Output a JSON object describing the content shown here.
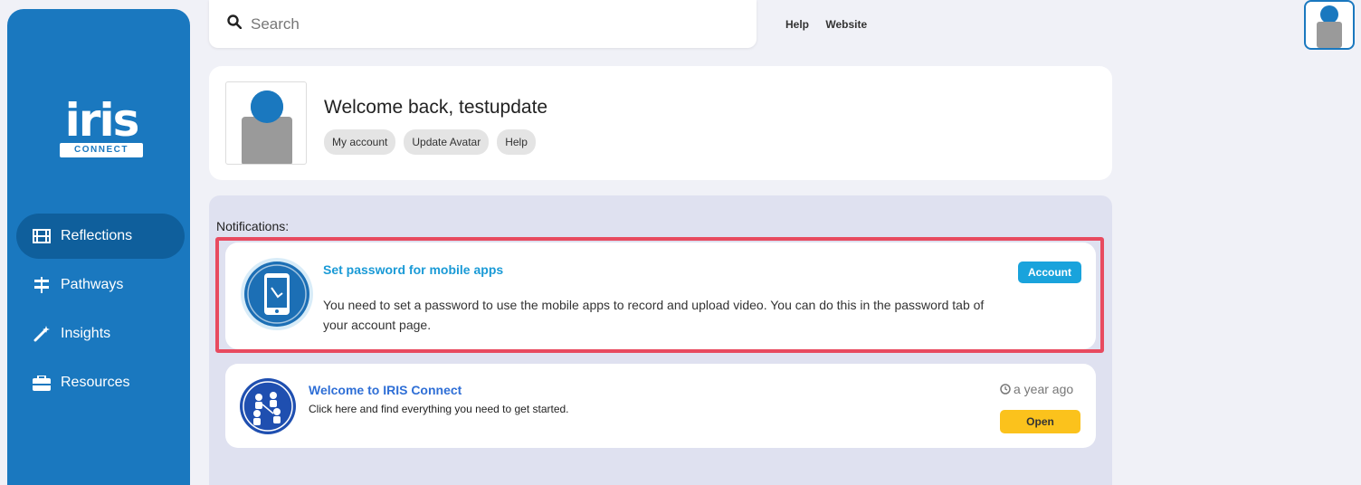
{
  "brand": {
    "logo_text": "iris",
    "logo_badge": "CONNECT",
    "color": "#1a78bf"
  },
  "sidebar": {
    "items": [
      {
        "label": "Reflections",
        "icon": "film-icon",
        "active": true
      },
      {
        "label": "Pathways",
        "icon": "signpost-icon",
        "active": false
      },
      {
        "label": "Insights",
        "icon": "magic-wand-icon",
        "active": false
      },
      {
        "label": "Resources",
        "icon": "briefcase-icon",
        "active": false
      }
    ]
  },
  "header": {
    "search_placeholder": "Search",
    "links": [
      "Help",
      "Website"
    ]
  },
  "welcome": {
    "title": "Welcome back, testupdate",
    "buttons": [
      "My account",
      "Update Avatar",
      "Help"
    ]
  },
  "notifications": {
    "heading": "Notifications:",
    "items": [
      {
        "title": "Set password for mobile apps",
        "body": "You need to set a password to use the mobile apps to record and upload video. You can do this in the password tab of your account page.",
        "action": "Account",
        "icon": "mobile-phone-icon",
        "highlighted": true
      },
      {
        "title": "Welcome to IRIS Connect",
        "body": "Click here and find everything you need to get started.",
        "timestamp": "a year ago",
        "action": "Open",
        "icon": "people-network-icon"
      }
    ]
  },
  "colors": {
    "accent": "#1a9ad6",
    "highlight_border": "#e84a5f",
    "open_button": "#fbc21c",
    "panel_bg": "#dfe1f0"
  }
}
